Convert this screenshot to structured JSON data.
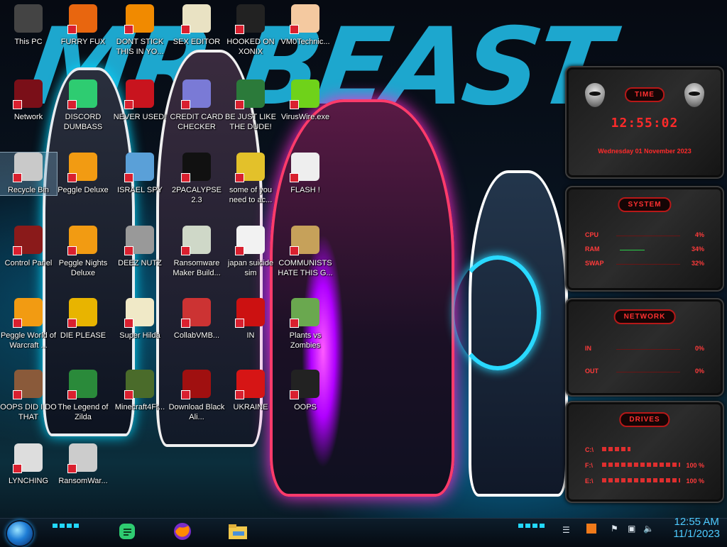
{
  "wallpaper_text": "MR BEAST",
  "icons": [
    {
      "label": "This PC",
      "icon": "computer-icon",
      "color": "#444"
    },
    {
      "label": "FURRY FUX",
      "icon": "firefox-icon",
      "color": "#e8660f"
    },
    {
      "label": "DONT STICK THIS IN YO...",
      "icon": "vlc-cone-icon",
      "color": "#f18a00"
    },
    {
      "label": "SEX EDITOR",
      "icon": "hxd-icon",
      "color": "#e9e2c3"
    },
    {
      "label": "HOOKED ON XONIX",
      "icon": "xonix-icon",
      "color": "#222"
    },
    {
      "label": "VM0Technic...",
      "icon": "doctor-icon",
      "color": "#f4c9a0"
    },
    {
      "label": "Network",
      "icon": "network-globe-icon",
      "color": "#7a0f18"
    },
    {
      "label": "DISCORD DUMBASS",
      "icon": "chat-bubble-icon",
      "color": "#2ecc71"
    },
    {
      "label": "NEVER USED!",
      "icon": "devcpp-icon",
      "color": "#c8141e"
    },
    {
      "label": "CREDIT CARD CHECKER",
      "icon": "credit-card-icon",
      "color": "#7a7ad6"
    },
    {
      "label": "BE JUST LIKE THE DUDE!",
      "icon": "santa-icon",
      "color": "#2b7a3a"
    },
    {
      "label": "VirusWire.exe",
      "icon": "lime-icon",
      "color": "#6fd21a"
    },
    {
      "label": "Recycle Bin",
      "icon": "recycle-bin-icon",
      "color": "#c9c9c9"
    },
    {
      "label": "Peggle Deluxe",
      "icon": "peggle-icon",
      "color": "#f29b12"
    },
    {
      "label": "ISRAEL SPY",
      "icon": "spy-window-icon",
      "color": "#5aa0d8"
    },
    {
      "label": "2PACALYPSE 2.3",
      "icon": "terminal-icon",
      "color": "#111"
    },
    {
      "label": "some of you need to ac...",
      "icon": "dog-icon",
      "color": "#e3c12a"
    },
    {
      "label": "FLASH !",
      "icon": "flash-card-icon",
      "color": "#eee"
    },
    {
      "label": "Control Panel",
      "icon": "control-panel-icon",
      "color": "#8a1a1a"
    },
    {
      "label": "Peggle Nights Deluxe",
      "icon": "peggle-nights-icon",
      "color": "#f29b12"
    },
    {
      "label": "DEEZ NUTZ",
      "icon": "windows-stack-icon",
      "color": "#999"
    },
    {
      "label": "Ransomware Maker Build...",
      "icon": "window-app-icon",
      "color": "#cfd8c8"
    },
    {
      "label": "japan suicide sim",
      "icon": "document-icon",
      "color": "#f2f2f2"
    },
    {
      "label": "COMMUNISTS HATE THIS G...",
      "icon": "money-bag-icon",
      "color": "#c6a15a"
    },
    {
      "label": "Peggle World of Warcraft ...",
      "icon": "peggle-wow-icon",
      "color": "#f29b12"
    },
    {
      "label": "DIE PLEASE",
      "icon": "de-icon",
      "color": "#e8b400"
    },
    {
      "label": "Super Hilda",
      "icon": "pixel-character-icon",
      "color": "#f0e9c7"
    },
    {
      "label": "CollabVMB...",
      "icon": "computer-monitor-icon",
      "color": "#c33"
    },
    {
      "label": "IN",
      "icon": "red-record-icon",
      "color": "#c11"
    },
    {
      "label": "Plants vs Zombies",
      "icon": "plant-icon",
      "color": "#6aa84f"
    },
    {
      "label": "OOPS DID I DO THAT",
      "icon": "portrait-icon",
      "color": "#8a5a3a"
    },
    {
      "label": "The Legend of Zilda",
      "icon": "zelda-icon",
      "color": "#2a8a3a"
    },
    {
      "label": "Minecraft4Fr...",
      "icon": "grass-block-icon",
      "color": "#4a6b2a"
    },
    {
      "label": "Download Black Ali...",
      "icon": "alienware-icon",
      "color": "#a01010"
    },
    {
      "label": "UKRAINE",
      "icon": "radiation-icon",
      "color": "#d61515"
    },
    {
      "label": "OOPS",
      "icon": "dark-monitor-icon",
      "color": "#222"
    },
    {
      "label": "LYNCHING",
      "icon": "noose-icon",
      "color": "#ddd"
    },
    {
      "label": "RansomWar...",
      "icon": "skull-icon",
      "color": "#ccc"
    }
  ],
  "widgets": {
    "time": {
      "title": "TIME",
      "clock": "12:55:02",
      "date": "Wednesday 01 November 2023"
    },
    "system": {
      "title": "SYSTEM",
      "rows": [
        {
          "label": "CPU",
          "value": "4%"
        },
        {
          "label": "RAM",
          "value": "34%"
        },
        {
          "label": "SWAP",
          "value": "32%"
        }
      ]
    },
    "network": {
      "title": "NETWORK",
      "rows": [
        {
          "label": "IN",
          "value": "0%"
        },
        {
          "label": "OUT",
          "value": "0%"
        }
      ]
    },
    "drives": {
      "title": "DRIVES",
      "rows": [
        {
          "label": "C:\\",
          "value": ""
        },
        {
          "label": "F:\\",
          "value": "100 %"
        },
        {
          "label": "E:\\",
          "value": "100 %"
        }
      ]
    }
  },
  "taskbar": {
    "pinned": [
      "chat-app-icon",
      "firefox-icon",
      "file-explorer-icon"
    ],
    "clock_time": "12:55 AM",
    "clock_date": "11/1/2023"
  },
  "colors": {
    "widget_accent": "#ff2a2a",
    "taskbar_accent": "#22d8ff",
    "time_color": "#4ecbff"
  }
}
